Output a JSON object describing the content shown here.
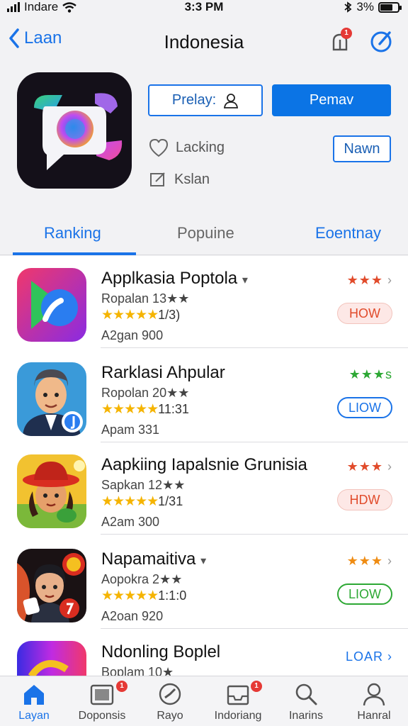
{
  "status_bar": {
    "carrier": "Indare",
    "time": "3:3 PM",
    "battery": "3%"
  },
  "nav": {
    "back_label": "Laan",
    "title": "Indonesia",
    "notification_count": "1"
  },
  "header": {
    "primary_outline_label": "Prelay:",
    "primary_label": "Pemav",
    "meta_lines": [
      "Lacking",
      "Kslan"
    ],
    "small_button_label": "Nawn"
  },
  "tabs": [
    {
      "label": "Ranking",
      "active": true
    },
    {
      "label": "Popuine",
      "active": false
    },
    {
      "label": "Eoentnay",
      "active": false
    }
  ],
  "apps": [
    {
      "title": "Applkasia Poptola",
      "title_suffix": "▾",
      "subtitle": "Ropalan  13★★",
      "stars": "★★★★★",
      "stars_text": "1/3)",
      "meta": "A2gan 900",
      "rating": "★★★",
      "rating_color": "#e14b2b",
      "action": "HOW",
      "action_style": "red"
    },
    {
      "title": "Rarklasi Ahpular",
      "title_suffix": "",
      "subtitle": "Ropolan  20★★",
      "stars": "★★★★★",
      "stars_text": "11:31",
      "meta": "Apam 331",
      "rating": "★★★s",
      "rating_color": "#2da834",
      "action": "LIOW",
      "action_style": "blue"
    },
    {
      "title": "Aapkiing Iapalsnie Grunisia",
      "title_suffix": "",
      "subtitle": "Sapkan  12★★",
      "stars": "★★★★★",
      "stars_text": "1/31",
      "meta": "A2am 300",
      "rating": "★★★",
      "rating_color": "#e14b2b",
      "action": "HDW",
      "action_style": "red"
    },
    {
      "title": "Napamaitiva",
      "title_suffix": "▾",
      "subtitle": "Aopokra  2★★",
      "stars": "★★★★★",
      "stars_text": "1:1:0",
      "meta": "A2oan 920",
      "rating": "★★★",
      "rating_color": "#ef8c13",
      "action": "LIOW",
      "action_style": "green"
    },
    {
      "title": "Ndonling Boplel",
      "title_suffix": "",
      "subtitle": "Boplam  10★",
      "stars": "",
      "stars_text": "",
      "meta": "",
      "rating": "",
      "rating_color": "#1a73e8",
      "action": "LOAR ›",
      "action_style": "link"
    }
  ],
  "tab_bar": [
    {
      "label": "Layan",
      "icon": "home-icon",
      "active": true,
      "badge": ""
    },
    {
      "label": "Doponsis",
      "icon": "photo-icon",
      "active": false,
      "badge": "1"
    },
    {
      "label": "Rayo",
      "icon": "compass-icon",
      "active": false,
      "badge": ""
    },
    {
      "label": "Indoriang",
      "icon": "inbox-icon",
      "active": false,
      "badge": "1"
    },
    {
      "label": "Inarins",
      "icon": "search-icon",
      "active": false,
      "badge": ""
    },
    {
      "label": "Hanral",
      "icon": "person-icon",
      "active": false,
      "badge": ""
    }
  ],
  "colors": {
    "accent": "#1a73e8",
    "primary_button": "#0b74e5",
    "star": "#f5b400",
    "badge": "#e53935"
  }
}
